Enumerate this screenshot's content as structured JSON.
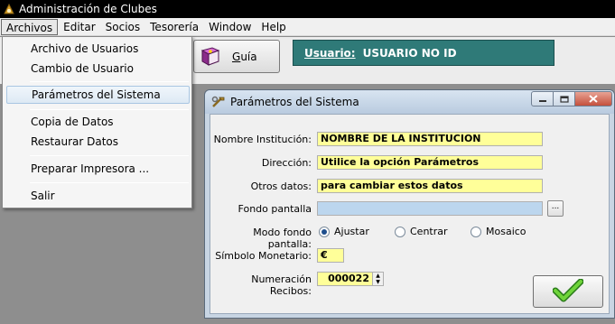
{
  "window": {
    "title": "Administración de Clubes"
  },
  "menubar": {
    "items": [
      "Archivos",
      "Editar",
      "Socios",
      "Tesorería",
      "Window",
      "Help"
    ],
    "open_index": 0
  },
  "archivos_menu": {
    "items": [
      "Archivo de Usuarios",
      "Cambio de Usuario",
      "Parámetros del Sistema",
      "Copia de Datos",
      "Restaurar Datos",
      "Preparar Impresora ...",
      "Salir"
    ],
    "highlighted": "Parámetros del Sistema"
  },
  "toolbar": {
    "guia_label": "Guía",
    "guia_mnemonic": "G",
    "guia_rest": "uía"
  },
  "user_panel": {
    "label": "Usuario:",
    "value": "USUARIO NO ID",
    "color": "#2f7a78"
  },
  "dialog": {
    "title": "Parámetros del Sistema",
    "fields": {
      "institucion": {
        "label": "Nombre Institución:",
        "value": "NOMBRE DE LA INSTITUCION"
      },
      "direccion": {
        "label": "Dirección:",
        "value": "Utilice la opción Parámetros"
      },
      "otros": {
        "label": "Otros datos:",
        "value": "para cambiar estos datos"
      },
      "fondo": {
        "label": "Fondo pantalla",
        "value": "",
        "browse_label": "..."
      },
      "modo": {
        "label": "Modo fondo pantalla:",
        "options": [
          "Ajustar",
          "Centrar",
          "Mosaico"
        ],
        "selected": "Ajustar"
      },
      "simbolo": {
        "label": "Símbolo Monetario:",
        "value": "€"
      },
      "recibos": {
        "label": "Numeración Recibos:",
        "value": "000022"
      }
    },
    "field_color": "#ffff99",
    "ok_icon": "green-check-icon"
  }
}
